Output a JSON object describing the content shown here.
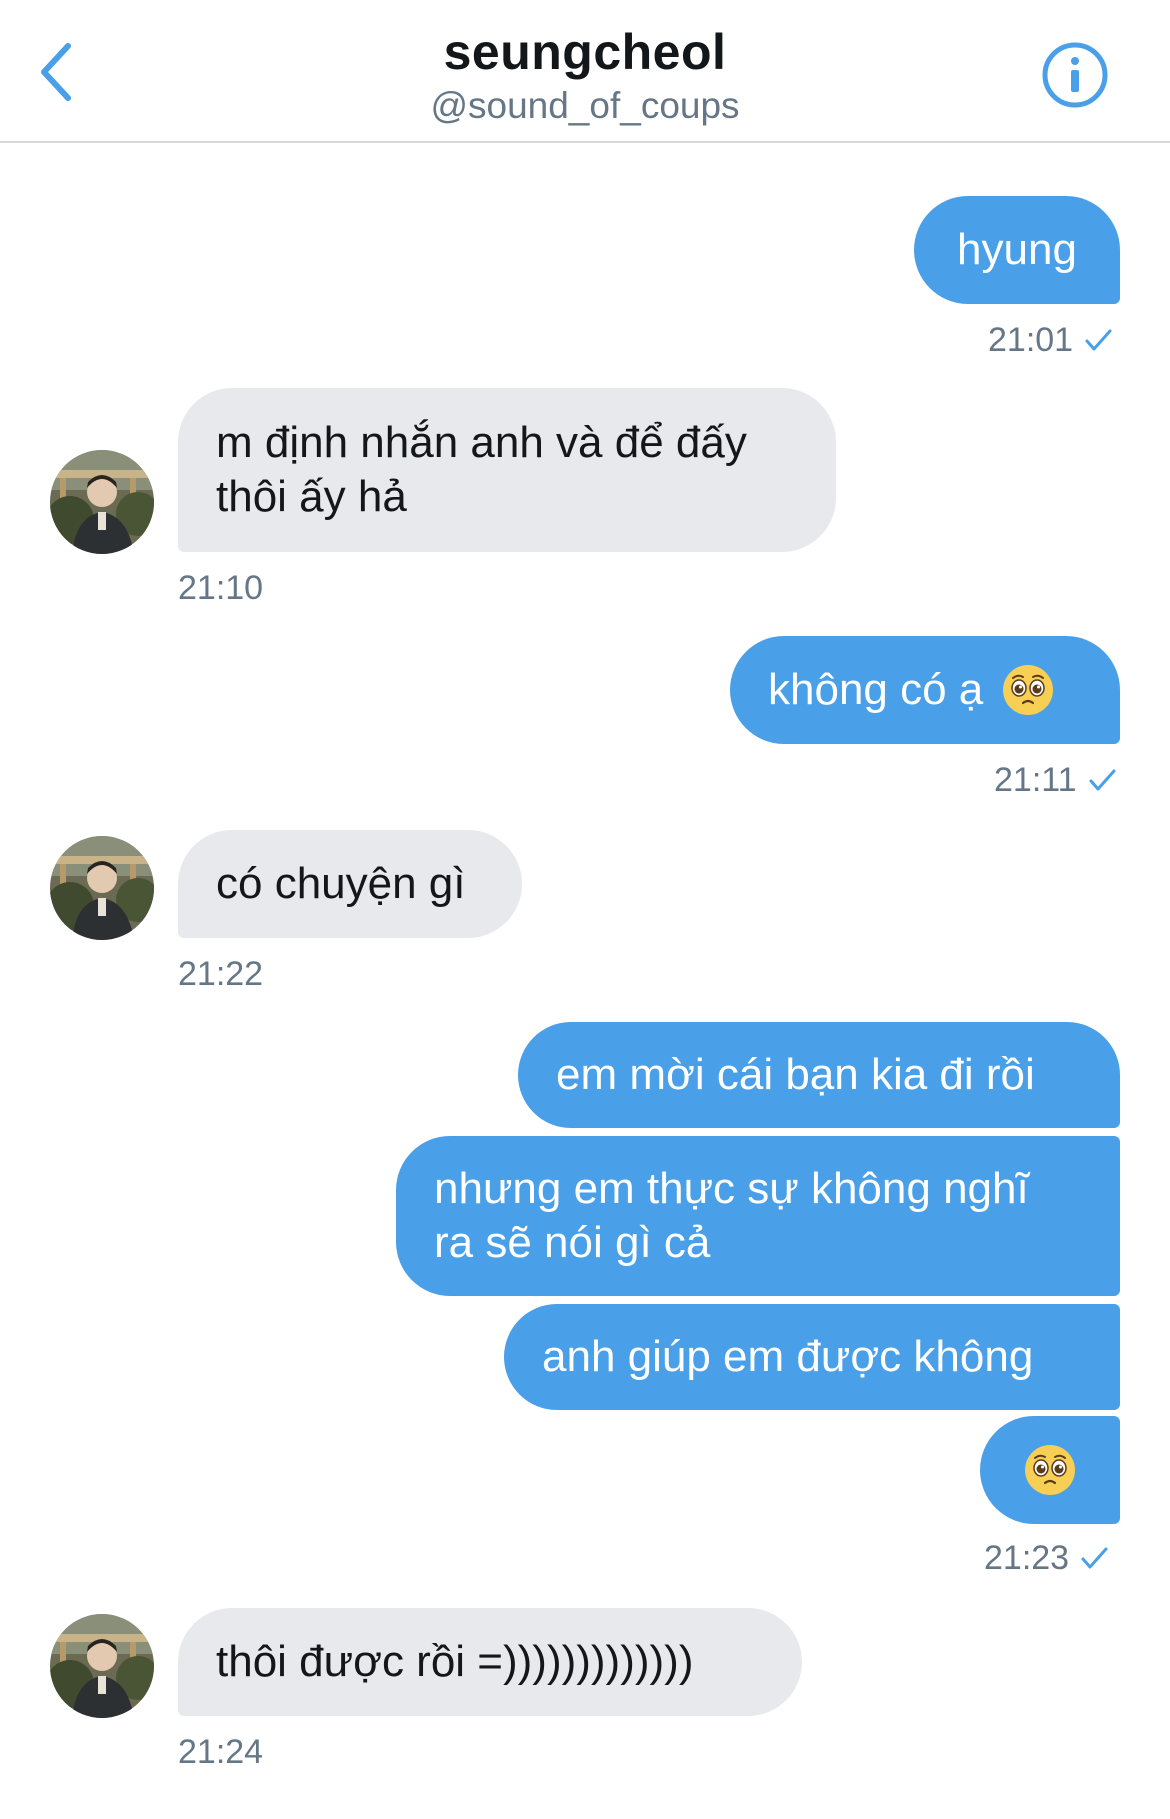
{
  "header": {
    "title": "seungcheol",
    "handle": "@sound_of_coups"
  },
  "colors": {
    "accent": "#4a9fe9",
    "received_bubble": "#e7e9ec",
    "timestamp": "#657786"
  },
  "icons": [
    "back-chevron-icon",
    "info-icon",
    "read-check-icon",
    "pleading-face-emoji"
  ],
  "messages": [
    {
      "side": "sent",
      "text": "hyung"
    },
    {
      "side": "received",
      "line1": "m định nhắn anh và để đấy",
      "line2": "thôi ấy hả"
    },
    {
      "side": "sent",
      "text": "không có ạ",
      "emoji": "pleading-face"
    },
    {
      "side": "received",
      "text": "có chuyện gì"
    },
    {
      "side": "sent",
      "text": "em mời cái bạn kia đi rồi"
    },
    {
      "side": "sent",
      "line1": "nhưng em thực sự không nghĩ",
      "line2": "ra sẽ nói gì cả"
    },
    {
      "side": "sent",
      "text": "anh giúp em được không"
    },
    {
      "side": "sent",
      "emoji": "pleading-face"
    },
    {
      "side": "received",
      "text": "thôi được rồi =)))))))))))))"
    }
  ],
  "timestamps": {
    "t1": "21:01",
    "t2": "21:10",
    "t3": "21:11",
    "t4": "21:22",
    "t5": "21:23",
    "t6": "21:24"
  }
}
